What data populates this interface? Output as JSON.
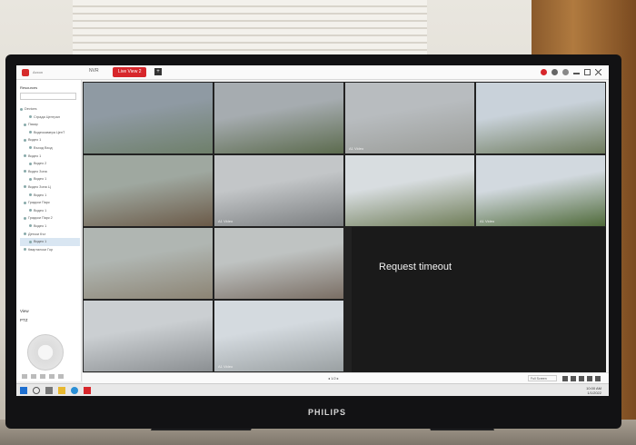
{
  "app": {
    "title": "Axxon",
    "tabs": [
      {
        "label": "NVR"
      },
      {
        "label": "Live View 2"
      }
    ],
    "add_tab": "+"
  },
  "sidebar": {
    "header": "Resources",
    "tree": [
      "Devices",
      "Сграда Централ",
      "Пазар",
      "Видеокамера ЦенТ",
      "Видео 1",
      "Въход Вход",
      "Видео 1",
      "Видео 2",
      "Видео Зона",
      "Видео 1",
      "Видео Зона Ц",
      "Видео 1",
      "Градски Парк",
      "Видео 1",
      "Градски Парк 2",
      "Видео 1",
      "Детски Кът",
      "Видео 1",
      "Кварталски Гор"
    ],
    "selected_index": 17,
    "view_label": "View",
    "ptz_label": "PTZ"
  },
  "grid": {
    "cells": [
      {
        "label": ""
      },
      {
        "label": ""
      },
      {
        "label": "A1 Video"
      },
      {
        "label": ""
      },
      {
        "label": ""
      },
      {
        "label": "A1 Video"
      },
      {
        "label": ""
      },
      {
        "label": "A1 Video"
      },
      {
        "label": ""
      },
      {
        "label": ""
      },
      {
        "label": ""
      },
      {
        "label": "A1 Video"
      },
      {
        "label": ""
      },
      {
        "label": ""
      }
    ],
    "timeout_message": "Request timeout"
  },
  "bottombar": {
    "pager": "◂  1/2  ▸",
    "layout_select": "Full Screen"
  },
  "taskbar": {
    "time": "10:00 AM",
    "date": "1/1/2022"
  },
  "colors": {
    "accent": "#d7262b",
    "selection": "#d9e6f2"
  }
}
